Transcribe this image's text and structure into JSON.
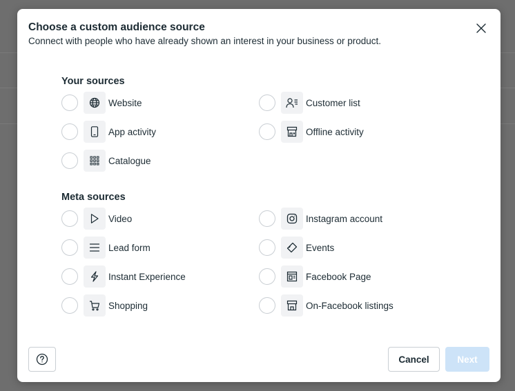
{
  "modal": {
    "title": "Choose a custom audience source",
    "subtitle": "Connect with people who have already shown an interest in your business or product."
  },
  "your_sources": {
    "title": "Your sources",
    "options": [
      {
        "label": "Website",
        "icon": "globe-icon",
        "selected": false
      },
      {
        "label": "Customer list",
        "icon": "contact-list-icon",
        "selected": false
      },
      {
        "label": "App activity",
        "icon": "mobile-phone-icon",
        "selected": false
      },
      {
        "label": "Offline activity",
        "icon": "store-icon",
        "selected": false
      },
      {
        "label": "Catalogue",
        "icon": "grid-icon",
        "selected": false
      }
    ]
  },
  "meta_sources": {
    "title": "Meta sources",
    "options": [
      {
        "label": "Video",
        "icon": "play-icon",
        "selected": false
      },
      {
        "label": "Instagram account",
        "icon": "instagram-icon",
        "selected": false
      },
      {
        "label": "Lead form",
        "icon": "lines-icon",
        "selected": false
      },
      {
        "label": "Events",
        "icon": "ticket-icon",
        "selected": false
      },
      {
        "label": "Instant Experience",
        "icon": "lightning-icon",
        "selected": false
      },
      {
        "label": "Facebook Page",
        "icon": "page-icon",
        "selected": false
      },
      {
        "label": "Shopping",
        "icon": "cart-icon",
        "selected": false
      },
      {
        "label": "On-Facebook listings",
        "icon": "storefront-icon",
        "selected": false
      }
    ]
  },
  "footer": {
    "cancel_label": "Cancel",
    "next_label": "Next",
    "help_icon": "question-circle-icon"
  },
  "colors": {
    "overlay": "#6e6e6e",
    "text": "#1c2b33",
    "next_disabled": "#cde3f8",
    "icon_bg": "#f1f2f4",
    "border": "#c9ced3"
  }
}
